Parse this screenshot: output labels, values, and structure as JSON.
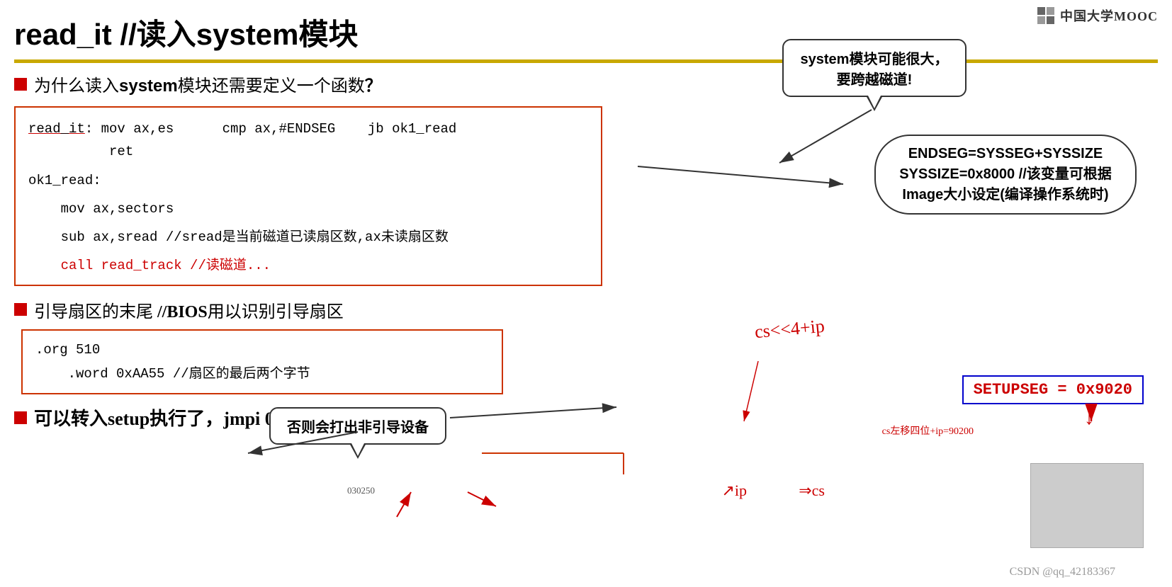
{
  "title": "read_it //读入system模块",
  "logo": {
    "text": "中国大学MOOC"
  },
  "gold_divider": true,
  "question": {
    "text": "为什么读入system模块还需要定义一个函数？"
  },
  "code": {
    "lines": [
      {
        "text": "read_it:  mov ax,es      cmp ax,#ENDSEG    jb ok1_read",
        "type": "normal",
        "underline": "read_it"
      },
      {
        "text": "          ret",
        "type": "normal"
      },
      {
        "blank": true
      },
      {
        "text": "ok1_read:",
        "type": "normal"
      },
      {
        "blank": true
      },
      {
        "text": "    mov ax,sectors",
        "type": "normal"
      },
      {
        "blank": true
      },
      {
        "text": "    sub ax,sread //sread是当前磁道已读扇区数,ax未读扇区数",
        "type": "normal"
      },
      {
        "blank": true
      },
      {
        "text": "    call read_track //读磁道...",
        "type": "red"
      }
    ]
  },
  "speech_bubble_top": {
    "text": "system模块可能很大，\n要跨越磁道!"
  },
  "endseg_box": {
    "line1": "ENDSEG=SYSSEG+SYSSIZE",
    "line2": "SYSSIZE=0x8000 //该变量可根据",
    "line3": "Image大小设定(编译操作系统时)"
  },
  "bullet2": {
    "text": "引导扇区的末尾 //BIOS用以识别引导扇区"
  },
  "org_block": {
    "lines": [
      ".org 510",
      "    .word 0xAA55 //扇区的最后两个字节"
    ]
  },
  "speech_bubble_mid": {
    "text": "否则会打出非引导设备"
  },
  "setupseg": {
    "text": "SETUPSEG = 0x9020"
  },
  "cs_annotation": "cs左移四位+ip=90200",
  "handwrite_csip": "cs<<4+ip",
  "handwrite_ip": "ip",
  "handwrite_cs": "⇒cs",
  "final_line": {
    "text": "■ 可以转入setup执行了，jmpi 0, SETUPSEG"
  },
  "csdn_watermark": "CSDN @qq_42183367",
  "num_annotation": "030250"
}
